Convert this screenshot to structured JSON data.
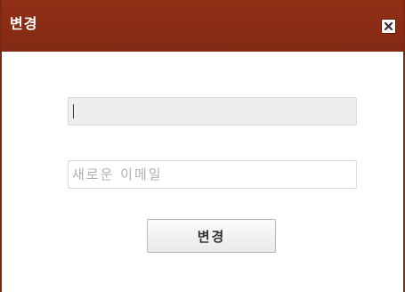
{
  "dialog": {
    "title": "변경",
    "close_icon": "close-icon"
  },
  "form": {
    "current_email": {
      "value": ""
    },
    "new_email": {
      "placeholder": "새로운 이메일",
      "value": ""
    },
    "submit_label": "변경"
  }
}
